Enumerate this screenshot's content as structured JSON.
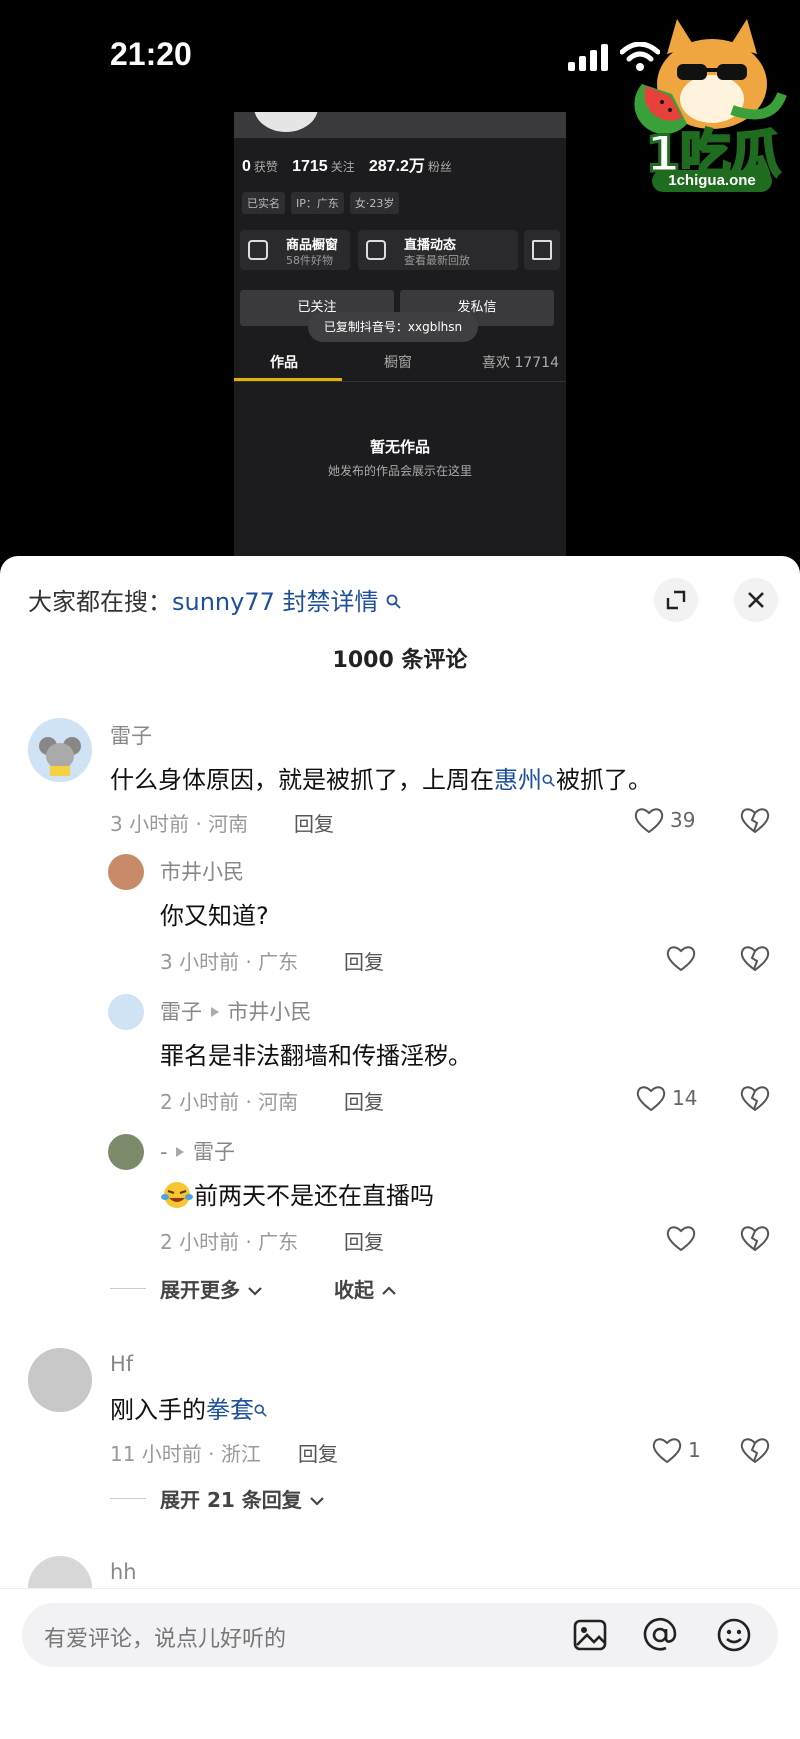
{
  "status_bar": {
    "time": "21:20"
  },
  "watermark": {
    "logo_text": "1吃瓜",
    "url": "1chigua.one"
  },
  "profile": {
    "stats": {
      "likes_value": "0",
      "likes_label": "获赞",
      "following_value": "1715",
      "following_label": "关注",
      "followers_value": "287.2万",
      "followers_label": "粉丝"
    },
    "tags": [
      "已实名",
      "IP：广东",
      "女·23岁"
    ],
    "cards": [
      {
        "title": "商品橱窗",
        "subtitle": "58件好物"
      },
      {
        "title": "直播动态",
        "subtitle": "查看最新回放"
      }
    ],
    "follow_button": "已关注",
    "message_button": "发私信",
    "toast": "已复制抖音号：xxgblhsn",
    "tabs": [
      "作品",
      "橱窗",
      "喜欢 17714"
    ],
    "empty_title": "暂无作品",
    "empty_subtitle": "她发布的作品会展示在这里"
  },
  "sheet": {
    "search_prefix": "大家都在搜：",
    "search_query": "sunny77 封禁详情",
    "comment_count": "1000 条评论"
  },
  "comments": [
    {
      "user": "雷子",
      "text_before": "什么身体原因，就是被抓了，上周在",
      "link": "惠州",
      "text_after": "被抓了。",
      "meta": "3 小时前 · 河南",
      "reply": "回复",
      "likes": "39"
    },
    {
      "user": "市井小民",
      "text": "你又知道?",
      "meta": "3 小时前 · 广东",
      "reply": "回复",
      "likes": ""
    },
    {
      "user": "雷子",
      "reply_to": "市井小民",
      "text": "罪名是非法翻墙和传播淫秽。",
      "meta": "2 小时前 · 河南",
      "reply": "回复",
      "likes": "14"
    },
    {
      "user": "-",
      "reply_to": "雷子",
      "text": "前两天不是还在直播吗",
      "meta": "2 小时前 · 广东",
      "reply": "回复",
      "likes": ""
    },
    {
      "user": "Hf",
      "text": "刚入手的",
      "link": "拳套",
      "meta": "11 小时前 · 浙江",
      "reply": "回复",
      "likes": "1"
    },
    {
      "user": "hh"
    }
  ],
  "expand_more": "展开更多",
  "collapse": "收起",
  "expand_replies": "展开 21 条回复",
  "input": {
    "placeholder": "有爱评论，说点儿好听的"
  },
  "icons": [
    "signal-icon",
    "wifi-icon",
    "expand-icon",
    "close-icon",
    "search-link-icon",
    "heart-icon",
    "dislike-heart-icon",
    "image-icon",
    "at-icon",
    "emoji-icon"
  ]
}
